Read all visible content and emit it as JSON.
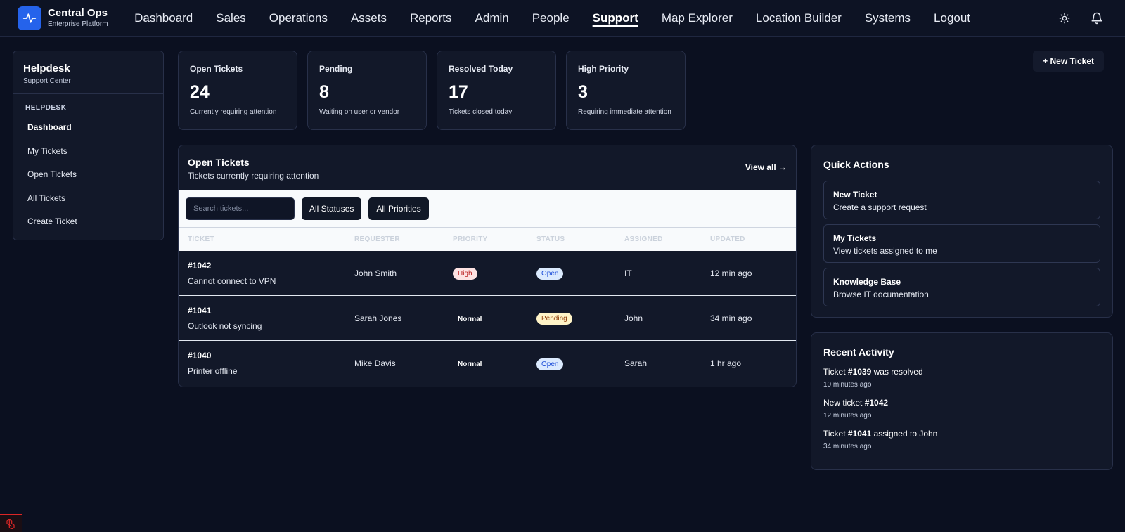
{
  "brand": {
    "title": "Central Ops",
    "subtitle": "Enterprise Platform"
  },
  "nav": {
    "items": [
      {
        "label": "Dashboard"
      },
      {
        "label": "Sales"
      },
      {
        "label": "Operations"
      },
      {
        "label": "Assets"
      },
      {
        "label": "Reports"
      },
      {
        "label": "Admin"
      },
      {
        "label": "People"
      },
      {
        "label": "Support"
      },
      {
        "label": "Map Explorer"
      },
      {
        "label": "Location Builder"
      },
      {
        "label": "Systems"
      },
      {
        "label": "Logout"
      }
    ],
    "active": "Support",
    "icons": [
      "sun-icon",
      "bell-icon"
    ]
  },
  "sidebar": {
    "title": "Helpdesk",
    "subtitle": "Support Center",
    "section": "HELPDESK",
    "items": [
      {
        "label": "Dashboard"
      },
      {
        "label": "My Tickets"
      },
      {
        "label": "Open Tickets"
      },
      {
        "label": "All Tickets"
      },
      {
        "label": "Create Ticket"
      }
    ]
  },
  "stats": [
    {
      "label": "Open Tickets",
      "value": "24",
      "desc": "Currently requiring attention"
    },
    {
      "label": "Pending",
      "value": "8",
      "desc": "Waiting on user or vendor"
    },
    {
      "label": "Resolved Today",
      "value": "17",
      "desc": "Tickets closed today"
    },
    {
      "label": "High Priority",
      "value": "3",
      "desc": "Requiring immediate attention"
    }
  ],
  "new_ticket_label": "+ New Ticket",
  "tickets_panel": {
    "title": "Open Tickets",
    "subtitle": "Tickets currently requiring attention",
    "view_all": "View all →",
    "search_placeholder": "Search tickets...",
    "status_filter": "All Statuses",
    "priority_filter": "All Priorities",
    "columns": [
      "TICKET",
      "REQUESTER",
      "PRIORITY",
      "STATUS",
      "ASSIGNED",
      "UPDATED"
    ],
    "rows": [
      {
        "id": "#1042",
        "subject": "Cannot connect to VPN",
        "requester": "John Smith",
        "priority": "High",
        "status": "Open",
        "assigned": "IT",
        "updated": "12 min ago"
      },
      {
        "id": "#1041",
        "subject": "Outlook not syncing",
        "requester": "Sarah Jones",
        "priority": "Normal",
        "status": "Pending",
        "assigned": "John",
        "updated": "34 min ago"
      },
      {
        "id": "#1040",
        "subject": "Printer offline",
        "requester": "Mike Davis",
        "priority": "Normal",
        "status": "Open",
        "assigned": "Sarah",
        "updated": "1 hr ago"
      }
    ]
  },
  "quick_actions": {
    "title": "Quick Actions",
    "items": [
      {
        "title": "New Ticket",
        "desc": "Create a support request"
      },
      {
        "title": "My Tickets",
        "desc": "View tickets assigned to me"
      },
      {
        "title": "Knowledge Base",
        "desc": "Browse IT documentation"
      }
    ]
  },
  "recent_activity": {
    "title": "Recent Activity",
    "items": [
      {
        "pre": "Ticket ",
        "bold": "#1039",
        "post": " was resolved",
        "time": "10 minutes ago"
      },
      {
        "pre": "New ticket ",
        "bold": "#1042",
        "post": "",
        "time": "12 minutes ago"
      },
      {
        "pre": "Ticket ",
        "bold": "#1041",
        "post": " assigned to John",
        "time": "34 minutes ago"
      }
    ]
  },
  "colors": {
    "accent": "#2563eb",
    "background": "#0b1020",
    "panel": "#121829",
    "high": "#b91c1c",
    "open": "#1d4ed8",
    "pending": "#92400e"
  }
}
